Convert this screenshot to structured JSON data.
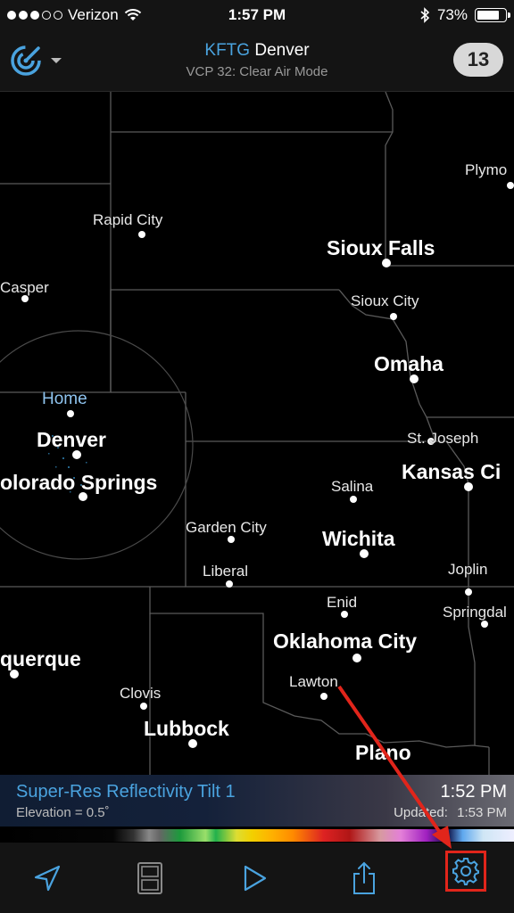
{
  "status_bar": {
    "carrier": "Verizon",
    "time": "1:57 PM",
    "battery": "73%"
  },
  "header": {
    "station_code": "KFTG",
    "station_city": "Denver",
    "mode": "VCP 32: Clear Air Mode",
    "badge_count": "13"
  },
  "map": {
    "cities": [
      {
        "name": "Plymo",
        "style": "minor"
      },
      {
        "name": "Rapid City",
        "style": "minor"
      },
      {
        "name": "Sioux Falls",
        "style": "major"
      },
      {
        "name": "Casper",
        "style": "minor"
      },
      {
        "name": "Sioux City",
        "style": "minor"
      },
      {
        "name": "Omaha",
        "style": "major"
      },
      {
        "name": "Home",
        "style": "home"
      },
      {
        "name": "Denver",
        "style": "major"
      },
      {
        "name": "St. Joseph",
        "style": "minor"
      },
      {
        "name": "Kansas Ci",
        "style": "major"
      },
      {
        "name": "olorado Springs",
        "style": "major"
      },
      {
        "name": "Salina",
        "style": "minor"
      },
      {
        "name": "Garden City",
        "style": "minor"
      },
      {
        "name": "Wichita",
        "style": "major"
      },
      {
        "name": "Liberal",
        "style": "minor"
      },
      {
        "name": "Joplin",
        "style": "minor"
      },
      {
        "name": "Enid",
        "style": "minor"
      },
      {
        "name": "Springdal",
        "style": "minor"
      },
      {
        "name": "Oklahoma City",
        "style": "major"
      },
      {
        "name": "querque",
        "style": "major"
      },
      {
        "name": "Lawton",
        "style": "minor"
      },
      {
        "name": "Clovis",
        "style": "minor"
      },
      {
        "name": "Lubbock",
        "style": "major"
      },
      {
        "name": "Plano",
        "style": "major"
      }
    ]
  },
  "info_panel": {
    "product": "Super-Res Reflectivity Tilt 1",
    "elevation": "Elevation = 0.5˚",
    "time": "1:52 PM",
    "updated_label": "Updated:",
    "updated_time": "1:53 PM"
  },
  "colors": {
    "accent": "#4aa3df",
    "highlight": "#e1251b"
  },
  "toolbar": {
    "icons": [
      "location-arrow-icon",
      "layout-icon",
      "play-icon",
      "share-icon",
      "gear-icon"
    ]
  }
}
